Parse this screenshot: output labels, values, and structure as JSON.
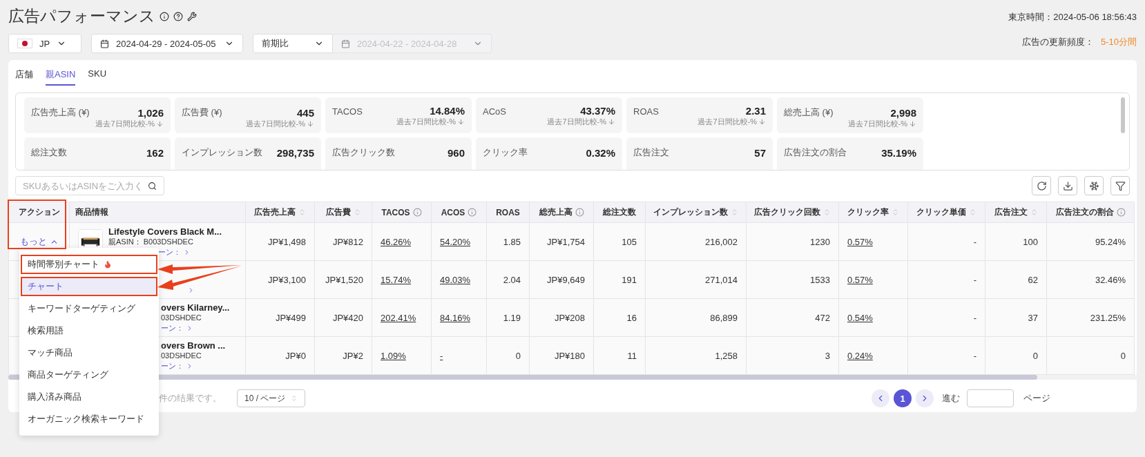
{
  "header": {
    "title": "広告パフォーマンス",
    "tokyo_time": "東京時間：2024-05-06 18:56:43",
    "update_label": "広告の更新頻度：",
    "update_value": "5-10分間"
  },
  "filters": {
    "marketplace": "JP",
    "date_range": "2024-04-29 - 2024-05-05",
    "compare_mode": "前期比",
    "compare_range": "2024-04-22 - 2024-04-28",
    "compare_disabled": true
  },
  "tabs": [
    {
      "label": "店舗",
      "selected": false
    },
    {
      "label": "親ASIN",
      "selected": true
    },
    {
      "label": "SKU",
      "selected": false
    }
  ],
  "metrics": [
    {
      "label": "広告売上高 (¥)",
      "value": "1,026",
      "sub": "過去7日間比較-%"
    },
    {
      "label": "広告費 (¥)",
      "value": "445",
      "sub": "過去7日間比較-%"
    },
    {
      "label": "TACOS",
      "value": "14.84%",
      "sub": "過去7日間比較-%"
    },
    {
      "label": "ACoS",
      "value": "43.37%",
      "sub": "過去7日間比較-%"
    },
    {
      "label": "ROAS",
      "value": "2.31",
      "sub": "過去7日間比較-%"
    },
    {
      "label": "総売上高 (¥)",
      "value": "2,998",
      "sub": "過去7日間比較-%"
    },
    {
      "label": "総注文数",
      "value": "162"
    },
    {
      "label": "インプレッション数",
      "value": "298,735"
    },
    {
      "label": "広告クリック数",
      "value": "960"
    },
    {
      "label": "クリック率",
      "value": "0.32%"
    },
    {
      "label": "広告注文",
      "value": "57"
    },
    {
      "label": "広告注文の割合",
      "value": "35.19%"
    }
  ],
  "search": {
    "placeholder": "SKUあるいはASINをご入力く"
  },
  "table": {
    "action_header": "アクション",
    "action_annotated": true,
    "product_header": "商品情報",
    "columns": [
      {
        "label": "広告売上高",
        "kind": "sort"
      },
      {
        "label": "広告費",
        "kind": "sort"
      },
      {
        "label": "TACOS",
        "kind": "info"
      },
      {
        "label": "ACOS",
        "kind": "info"
      },
      {
        "label": "ROAS",
        "kind": "plain"
      },
      {
        "label": "総売上高",
        "kind": "info"
      },
      {
        "label": "総注文数",
        "kind": "plain"
      },
      {
        "label": "インプレッション数",
        "kind": "sort"
      },
      {
        "label": "広告クリック回数",
        "kind": "sort"
      },
      {
        "label": "クリック率",
        "kind": "sort"
      },
      {
        "label": "クリック単価",
        "kind": "sort"
      },
      {
        "label": "広告注文",
        "kind": "sort"
      },
      {
        "label": "広告注文の割合",
        "kind": "info"
      }
    ],
    "rows": [
      {
        "action": "もっと",
        "product": {
          "kind": "full",
          "title": "Lifestyle Covers Black M...",
          "asin": "親ASIN： B003DSHDEC",
          "link": "ーン："
        },
        "cells": [
          {
            "text": "JP¥1,498",
            "underlined": false
          },
          {
            "text": "JP¥812",
            "underlined": false
          },
          {
            "text": "46.26%",
            "underlined": true
          },
          {
            "text": "54.20%",
            "underlined": true
          },
          {
            "text": "1.85",
            "underlined": false
          },
          {
            "text": "JP¥1,754",
            "underlined": false
          },
          {
            "text": "105",
            "underlined": false
          },
          {
            "text": "216,002",
            "underlined": false
          },
          {
            "text": "1230",
            "underlined": false
          },
          {
            "text": "0.57%",
            "underlined": true
          },
          {
            "text": "-",
            "underlined": false
          },
          {
            "text": "100",
            "underlined": false
          },
          {
            "text": "95.24%",
            "underlined": false
          }
        ]
      },
      {
        "product": {
          "kind": "cut"
        },
        "cells": [
          {
            "text": "JP¥3,100",
            "underlined": false
          },
          {
            "text": "JP¥1,520",
            "underlined": false
          },
          {
            "text": "15.74%",
            "underlined": true
          },
          {
            "text": "49.03%",
            "underlined": true
          },
          {
            "text": "2.04",
            "underlined": false
          },
          {
            "text": "JP¥9,649",
            "underlined": false
          },
          {
            "text": "191",
            "underlined": false
          },
          {
            "text": "271,014",
            "underlined": false
          },
          {
            "text": "1533",
            "underlined": false
          },
          {
            "text": "0.57%",
            "underlined": true
          },
          {
            "text": "-",
            "underlined": false
          },
          {
            "text": "62",
            "underlined": false
          },
          {
            "text": "32.46%",
            "underlined": false
          }
        ]
      },
      {
        "product": {
          "kind": "cut",
          "title": "overs Kilarney...",
          "asin": "03DSHDEC",
          "link": "ーン："
        },
        "cells": [
          {
            "text": "JP¥499",
            "underlined": false
          },
          {
            "text": "JP¥420",
            "underlined": false
          },
          {
            "text": "202.41%",
            "underlined": true
          },
          {
            "text": "84.16%",
            "underlined": true
          },
          {
            "text": "1.19",
            "underlined": false
          },
          {
            "text": "JP¥208",
            "underlined": false
          },
          {
            "text": "16",
            "underlined": false
          },
          {
            "text": "86,899",
            "underlined": false
          },
          {
            "text": "472",
            "underlined": false
          },
          {
            "text": "0.54%",
            "underlined": true
          },
          {
            "text": "-",
            "underlined": false
          },
          {
            "text": "37",
            "underlined": false
          },
          {
            "text": "231.25%",
            "underlined": false
          }
        ]
      },
      {
        "product": {
          "kind": "cut",
          "title": "overs Brown ...",
          "asin": "03DSHDEC",
          "link": "ーン："
        },
        "cells": [
          {
            "text": "JP¥0",
            "underlined": false
          },
          {
            "text": "JP¥2",
            "underlined": false
          },
          {
            "text": "1.09%",
            "underlined": true
          },
          {
            "text": "-",
            "underlined": true
          },
          {
            "text": "0",
            "underlined": false
          },
          {
            "text": "JP¥180",
            "underlined": false
          },
          {
            "text": "11",
            "underlined": false
          },
          {
            "text": "1,258",
            "underlined": false
          },
          {
            "text": "3",
            "underlined": false
          },
          {
            "text": "0.24%",
            "underlined": true
          },
          {
            "text": "-",
            "underlined": false
          },
          {
            "text": "0",
            "underlined": false
          },
          {
            "text": "0",
            "underlined": false
          }
        ]
      }
    ]
  },
  "pagination": {
    "summary": "件の结果です。",
    "page_size": "10 / ページ",
    "pages": [
      {
        "label": "1",
        "selected": true
      }
    ],
    "goto_label": "進む",
    "page_label": "ページ"
  },
  "menu": {
    "items": [
      {
        "label": "時間帯別チャート",
        "hot": true,
        "selected": false,
        "annotated": true
      },
      {
        "label": "チャート",
        "hot": false,
        "selected": true,
        "annotated": true
      },
      {
        "label": "キーワードターゲティング",
        "hot": false,
        "selected": false,
        "annotated": false
      },
      {
        "label": "検索用語",
        "hot": false,
        "selected": false,
        "annotated": false
      },
      {
        "label": "マッチ商品",
        "hot": false,
        "selected": false,
        "annotated": false
      },
      {
        "label": "商品ターゲティング",
        "hot": false,
        "selected": false,
        "annotated": false
      },
      {
        "label": "購入済み商品",
        "hot": false,
        "selected": false,
        "annotated": false
      },
      {
        "label": "オーガニック検索キーワード",
        "hot": false,
        "selected": false,
        "annotated": false
      }
    ]
  }
}
